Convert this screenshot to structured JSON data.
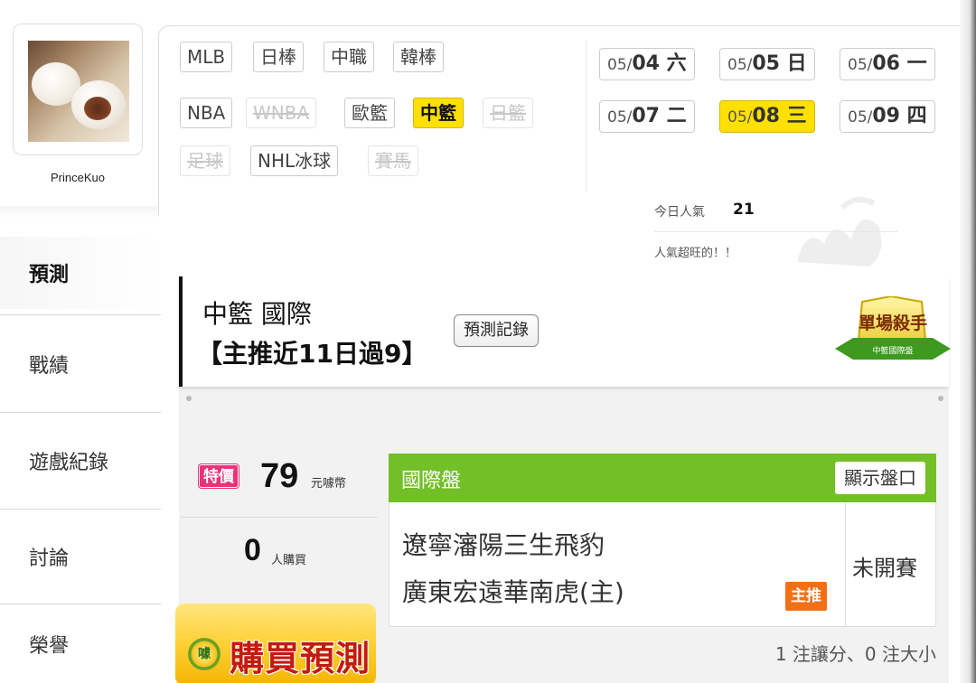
{
  "user": {
    "name": "PrinceKuo"
  },
  "sidebar": {
    "items": [
      {
        "label": "預測",
        "active": true
      },
      {
        "label": "戰績",
        "active": false
      },
      {
        "label": "遊戲紀錄",
        "active": false
      },
      {
        "label": "討論",
        "active": false
      },
      {
        "label": "榮譽",
        "active": false
      }
    ]
  },
  "sports": {
    "items": [
      {
        "label": "MLB",
        "state": "normal"
      },
      {
        "label": "日棒",
        "state": "normal"
      },
      {
        "label": "中職",
        "state": "normal"
      },
      {
        "label": "韓棒",
        "state": "normal"
      },
      {
        "label": "NBA",
        "state": "normal"
      },
      {
        "label": "WNBA",
        "state": "disabled"
      },
      {
        "label": "歐籃",
        "state": "normal"
      },
      {
        "label": "中籃",
        "state": "active"
      },
      {
        "label": "日籃",
        "state": "disabled"
      },
      {
        "label": "足球",
        "state": "disabled"
      },
      {
        "label": "NHL冰球",
        "state": "normal"
      },
      {
        "label": "賽馬",
        "state": "disabled"
      }
    ]
  },
  "dates": {
    "items": [
      {
        "prefix": "05/",
        "day": "04 六",
        "active": false
      },
      {
        "prefix": "05/",
        "day": "05 日",
        "active": false
      },
      {
        "prefix": "05/",
        "day": "06 一",
        "active": false
      },
      {
        "prefix": "05/",
        "day": "07 二",
        "active": false
      },
      {
        "prefix": "05/",
        "day": "08 三",
        "active": true
      },
      {
        "prefix": "05/",
        "day": "09 四",
        "active": false
      }
    ]
  },
  "popularity": {
    "label": "今日人氣",
    "value": "21",
    "note": "人氣超旺的！！"
  },
  "card": {
    "title": "中籃 國際",
    "subtitle": "【主推近11日過9】",
    "record_button": "預測記錄",
    "badge": {
      "main": "單場殺手",
      "sub": "中籃國際盤"
    },
    "price": {
      "tag": "特價",
      "value": "79",
      "unit": "元噱幣"
    },
    "buyers": {
      "value": "0",
      "unit": "人購買"
    },
    "buy_button": {
      "icon_text": "噱",
      "label": "購買預測"
    },
    "market": {
      "title": "國際盤",
      "show_button": "顯示盤口",
      "team_away": "遼寧瀋陽三生飛豹",
      "team_home": "廣東宏遠華南虎(主)",
      "pick_tag": "主推",
      "status": "未開賽"
    },
    "bet_summary": "1 注讓分、0 注大小"
  },
  "colors": {
    "highlight": "#ffe000",
    "market_green": "#73bf28",
    "special_pink": "#e8337b",
    "pick_orange": "#f26f16",
    "buy_red": "#c41a10"
  }
}
